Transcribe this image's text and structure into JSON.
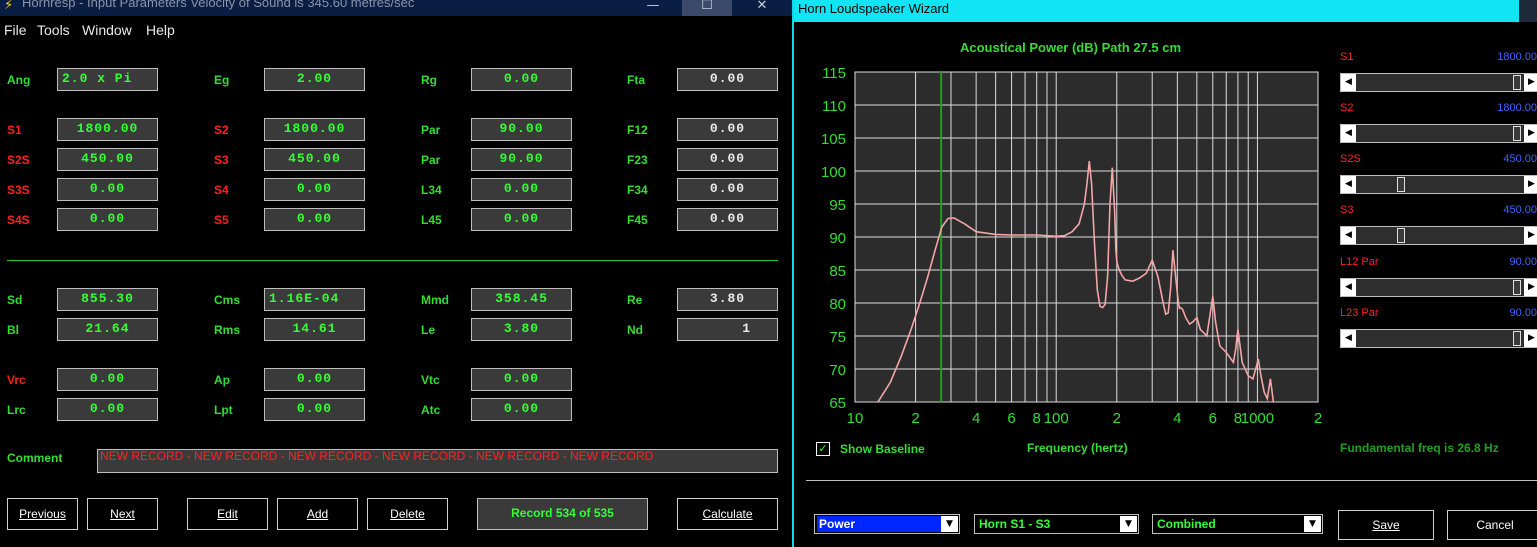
{
  "left_window": {
    "title": "Hornresp - Input Parameters   Velocity of Sound is 345.60 metres/sec",
    "controls": {
      "minimize": "—",
      "maximize": "☐",
      "close": "✕"
    },
    "menu": [
      "File",
      "Tools",
      "Window",
      "Help"
    ],
    "horn_params": [
      [
        {
          "label": "Ang",
          "value": "2.0 x Pi",
          "red": false
        },
        {
          "label": "Eg",
          "value": "2.00",
          "red": false
        },
        {
          "label": "Rg",
          "value": "0.00",
          "red": false
        },
        {
          "label": "Fta",
          "value": "0.00",
          "red": false,
          "white": true
        }
      ],
      [
        {
          "label": "S1",
          "value": "1800.00",
          "red": true
        },
        {
          "label": "S2",
          "value": "1800.00",
          "red": true
        },
        {
          "label": "Par",
          "value": "90.00",
          "red": false
        },
        {
          "label": "F12",
          "value": "0.00",
          "red": false,
          "white": true
        }
      ],
      [
        {
          "label": "S2S",
          "value": "450.00",
          "red": true
        },
        {
          "label": "S3",
          "value": "450.00",
          "red": true
        },
        {
          "label": "Par",
          "value": "90.00",
          "red": false
        },
        {
          "label": "F23",
          "value": "0.00",
          "red": false,
          "white": true
        }
      ],
      [
        {
          "label": "S3S",
          "value": "0.00",
          "red": true
        },
        {
          "label": "S4",
          "value": "0.00",
          "red": true
        },
        {
          "label": "L34",
          "value": "0.00",
          "red": false
        },
        {
          "label": "F34",
          "value": "0.00",
          "red": false,
          "white": true
        }
      ],
      [
        {
          "label": "S4S",
          "value": "0.00",
          "red": true
        },
        {
          "label": "S5",
          "value": "0.00",
          "red": true
        },
        {
          "label": "L45",
          "value": "0.00",
          "red": false
        },
        {
          "label": "F45",
          "value": "0.00",
          "red": false,
          "white": true
        }
      ]
    ],
    "driver_params": [
      [
        {
          "label": "Sd",
          "value": "855.30"
        },
        {
          "label": "Cms",
          "value": "1.16E-04"
        },
        {
          "label": "Mmd",
          "value": "358.45"
        },
        {
          "label": "Re",
          "value": "3.80",
          "white": true
        }
      ],
      [
        {
          "label": "Bl",
          "value": "21.64"
        },
        {
          "label": "Rms",
          "value": "14.61"
        },
        {
          "label": "Le",
          "value": "3.80"
        },
        {
          "label": "Nd",
          "value": "1",
          "white": true
        }
      ]
    ],
    "chamber_params": [
      [
        {
          "label": "Vrc",
          "value": "0.00",
          "red": true
        },
        {
          "label": "Ap",
          "value": "0.00",
          "red": false
        },
        {
          "label": "Vtc",
          "value": "0.00",
          "red": false
        }
      ],
      [
        {
          "label": "Lrc",
          "value": "0.00",
          "red": false
        },
        {
          "label": "Lpt",
          "value": "0.00",
          "red": false
        },
        {
          "label": "Atc",
          "value": "0.00",
          "red": false
        }
      ]
    ],
    "comment_label": "Comment",
    "comment_value": "NEW RECORD - NEW RECORD - NEW RECORD - NEW RECORD - NEW RECORD - NEW RECORD",
    "buttons": {
      "previous": "Previous",
      "next": "Next",
      "edit": "Edit",
      "add": "Add",
      "delete": "Delete",
      "calculate": "Calculate"
    },
    "record": "Record 534 of 535"
  },
  "right_window": {
    "title": "Horn Loudspeaker Wizard",
    "chart_title": "Acoustical Power (dB)   Path 27.5 cm",
    "sliders": [
      {
        "label": "S1",
        "value": "1800.00",
        "position": 0.99
      },
      {
        "label": "S2",
        "value": "1800.00",
        "position": 0.99
      },
      {
        "label": "S2S",
        "value": "450.00",
        "position": 0.25
      },
      {
        "label": "S3",
        "value": "450.00",
        "position": 0.25
      },
      {
        "label": "L12  Par",
        "value": "90.00",
        "position": 0.99
      },
      {
        "label": "L23  Par",
        "value": "90.00",
        "position": 0.99
      }
    ],
    "show_baseline": {
      "label": "Show Baseline",
      "checked": true,
      "check_glyph": "✓"
    },
    "x_axis_label": "Frequency (hertz)",
    "fundamental": "Fundamental freq is 26.8 Hz",
    "combos": {
      "display": "Power",
      "path": "Horn S1 - S3",
      "mode": "Combined",
      "arrow": "▼"
    },
    "save": "Save",
    "cancel": "Cancel"
  },
  "chart_data": {
    "type": "line",
    "title": "Acoustical Power (dB)   Path 27.5 cm",
    "xlabel": "Frequency (hertz)",
    "ylabel": "",
    "xscale": "log",
    "xlim": [
      10,
      2000
    ],
    "ylim": [
      65,
      115
    ],
    "y_ticks": [
      "65",
      "70",
      "75",
      "80",
      "85",
      "90",
      "95",
      "100",
      "105",
      "110",
      "115"
    ],
    "x_ticks": [
      "10",
      "2",
      "4",
      "6",
      "8",
      "100",
      "2",
      "4",
      "6",
      "8",
      "1000",
      "2"
    ],
    "x_tick_values": [
      10,
      20,
      40,
      60,
      80,
      100,
      200,
      400,
      600,
      800,
      1000,
      2000
    ],
    "grid": true,
    "marker_frequency": 26.8,
    "colors": {
      "curve": "#f4a6a6",
      "marker": "#1fa01f",
      "grid": "#dcdcdc",
      "plot_bg": "#2c2c2c",
      "axis_text": "#33dd33"
    },
    "series": [
      {
        "x": [
          13,
          15,
          17,
          19,
          21,
          23,
          25,
          27,
          29,
          31,
          35,
          40,
          50,
          60,
          80,
          100,
          110,
          120,
          130,
          138,
          142,
          146,
          150,
          155,
          160,
          165,
          170,
          175,
          180,
          185,
          190,
          195,
          198,
          200,
          203,
          207,
          212,
          220,
          240,
          260,
          280,
          300,
          320,
          340,
          350,
          360,
          370,
          380,
          395,
          405,
          410,
          415,
          425,
          440,
          460,
          480,
          500,
          520,
          540,
          560,
          580,
          600,
          620,
          650,
          700,
          760,
          780,
          800,
          840,
          900,
          950,
          990,
          1010,
          1040,
          1080,
          1120,
          1160,
          1200
        ],
        "y": [
          65,
          68,
          72,
          76,
          80,
          84,
          88,
          91.5,
          92.8,
          92.9,
          92,
          90.8,
          90.4,
          90.3,
          90.3,
          90.1,
          90.2,
          90.8,
          92,
          95,
          98,
          101.5,
          98,
          89,
          82,
          79.5,
          79.3,
          79.8,
          84,
          95,
          100.5,
          94,
          88,
          86.3,
          85.5,
          84.8,
          84.2,
          83.5,
          83.3,
          83.8,
          84.5,
          86.5,
          84,
          80,
          78.3,
          78.5,
          82,
          88,
          83,
          80,
          79.2,
          79.3,
          79,
          77.8,
          76.8,
          77.2,
          77.8,
          76,
          75.5,
          75,
          78,
          81,
          77,
          73.5,
          72.5,
          71,
          73,
          76,
          71,
          69,
          68.5,
          70.5,
          71.5,
          69,
          66.5,
          65.5,
          68.5,
          65
        ]
      }
    ]
  }
}
